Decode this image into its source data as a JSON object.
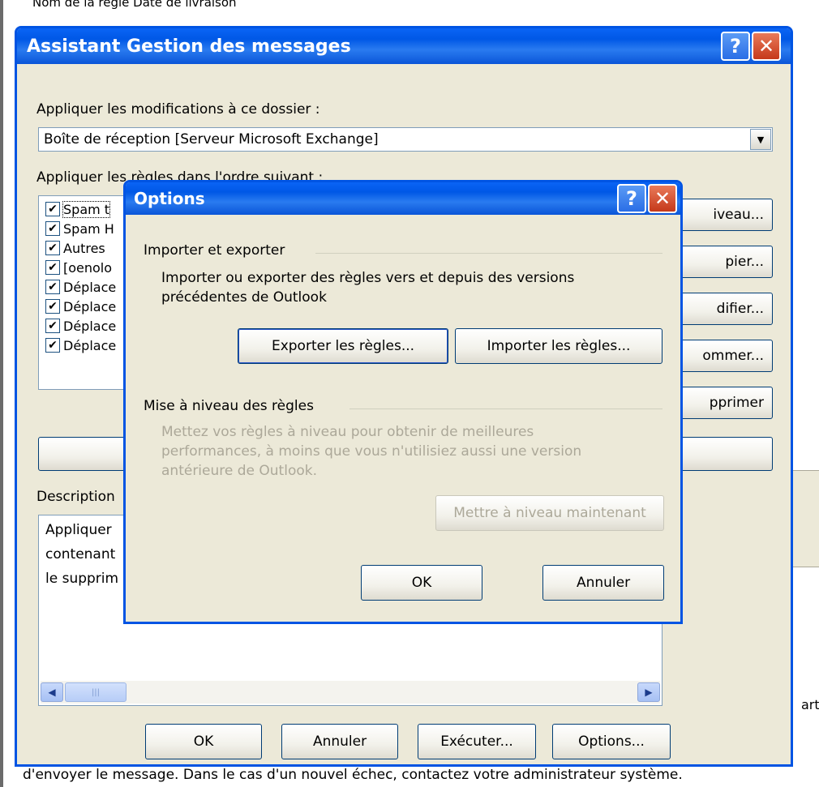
{
  "background": {
    "top_text": "Nom de la règle                 Date de livraison",
    "right_fragment": "arti",
    "bottom_text": "d'envoyer le message. Dans le cas d'un nouvel échec, contactez votre administrateur système."
  },
  "main_window": {
    "title": "Assistant Gestion des messages",
    "apply_folder_label": "Appliquer les modifications à ce dossier :",
    "folder_value": "Boîte de réception [Serveur Microsoft Exchange]",
    "rules_order_label": "Appliquer les règles dans l'ordre suivant :",
    "rules": [
      {
        "label": "Spam t",
        "checked": true
      },
      {
        "label": "Spam H",
        "checked": true
      },
      {
        "label": "Autres",
        "checked": true
      },
      {
        "label": "[oenolo",
        "checked": true
      },
      {
        "label": "Déplace",
        "checked": true
      },
      {
        "label": "Déplace",
        "checked": true
      },
      {
        "label": "Déplace",
        "checked": true
      },
      {
        "label": "Déplace",
        "checked": true
      }
    ],
    "side_buttons": [
      "iveau...",
      "pier...",
      "difier...",
      "ommer...",
      "pprimer"
    ],
    "description_label": "Description",
    "description_lines": [
      "Appliquer",
      "contenant",
      "le supprim"
    ],
    "bottom_buttons": {
      "ok": "OK",
      "cancel": "Annuler",
      "run": "Exécuter...",
      "options": "Options..."
    }
  },
  "options_dialog": {
    "title": "Options",
    "import_export_group": "Importer et exporter",
    "import_export_desc_1": "Importer ou exporter des règles vers et depuis des versions",
    "import_export_desc_2": "précédentes de Outlook",
    "export_button": "Exporter les règles...",
    "import_button": "Importer les règles...",
    "upgrade_group": "Mise à niveau des règles",
    "upgrade_desc_1": "Mettez vos règles à niveau pour obtenir de meilleures",
    "upgrade_desc_2": "performances, à moins que vous n'utilisiez aussi une version",
    "upgrade_desc_3": "antérieure de Outlook.",
    "upgrade_button": "Mettre à niveau maintenant",
    "ok_button": "OK",
    "cancel_button": "Annuler"
  },
  "colors": {
    "titlebar": "#0058e6",
    "dialog_bg": "#ece9d8",
    "close_red": "#c5391a",
    "disabled_text": "#aca899"
  }
}
